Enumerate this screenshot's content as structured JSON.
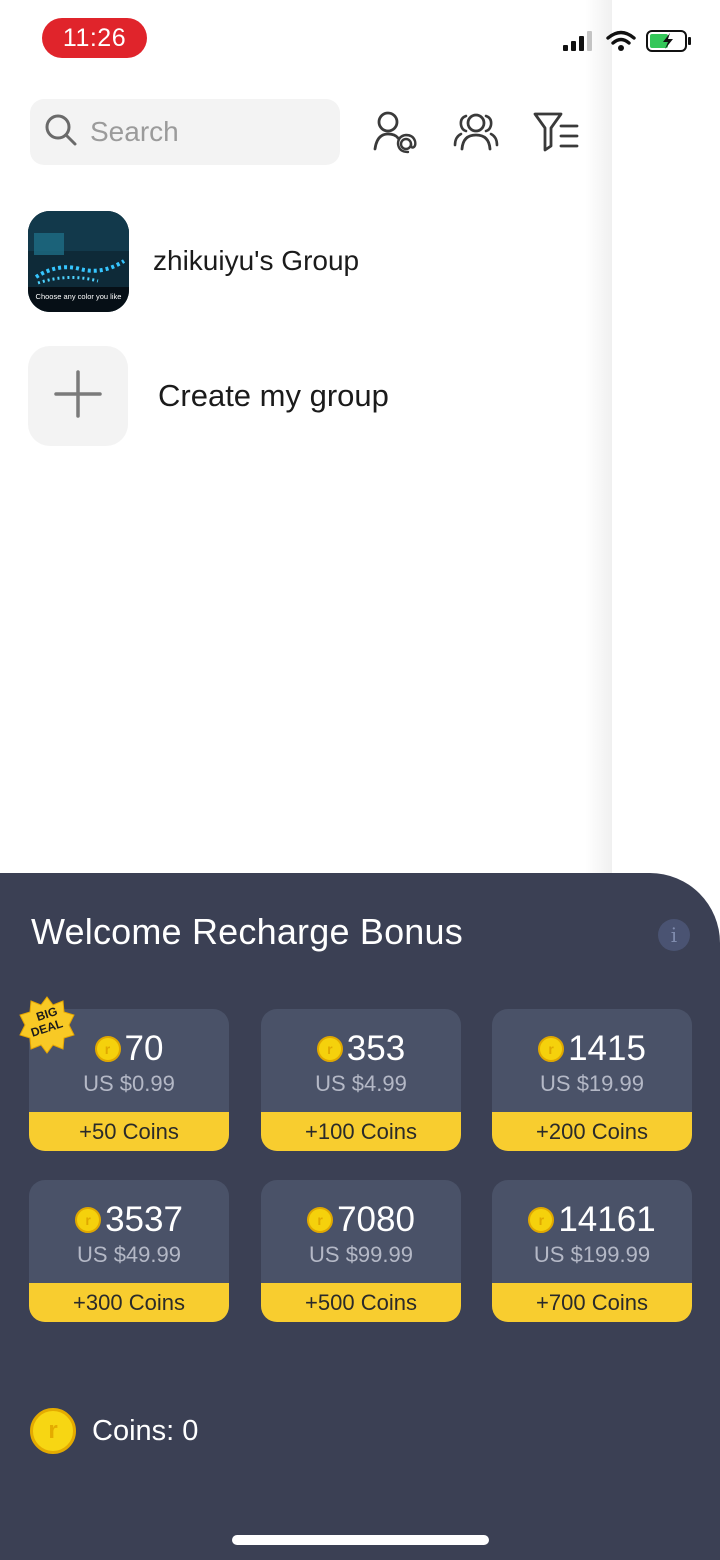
{
  "status_bar": {
    "time": "11:26",
    "time_pill_color": "#e0242b",
    "icons": [
      "signal-icon",
      "wifi-icon",
      "battery-charging-icon"
    ]
  },
  "search": {
    "placeholder": "Search",
    "icons": [
      "search-icon",
      "mention-contact-icon",
      "group-people-icon",
      "filter-list-icon"
    ]
  },
  "groups": [
    {
      "name": "zhikuiyu's Group",
      "thumbnail_caption": "Choose any color you like"
    }
  ],
  "create_group": {
    "label": "Create my group",
    "icon": "plus-icon"
  },
  "recharge": {
    "title": "Welcome Recharge Bonus",
    "info_label": "i",
    "badge": [
      "BIG",
      "DEAL"
    ],
    "packs": [
      {
        "coins": "70",
        "price": "US $0.99",
        "bonus": "+50 Coins"
      },
      {
        "coins": "353",
        "price": "US $4.99",
        "bonus": "+100 Coins"
      },
      {
        "coins": "1415",
        "price": "US $19.99",
        "bonus": "+200 Coins"
      },
      {
        "coins": "3537",
        "price": "US $49.99",
        "bonus": "+300 Coins"
      },
      {
        "coins": "7080",
        "price": "US $99.99",
        "bonus": "+500 Coins"
      },
      {
        "coins": "14161",
        "price": "US $199.99",
        "bonus": "+700 Coins"
      }
    ],
    "balance": "Coins: 0",
    "colors": {
      "sheet_bg": "#3b4054",
      "pack_bg": "#4a5268",
      "bonus_bg": "#f8cd2f",
      "coin": "#f5d10c"
    }
  }
}
